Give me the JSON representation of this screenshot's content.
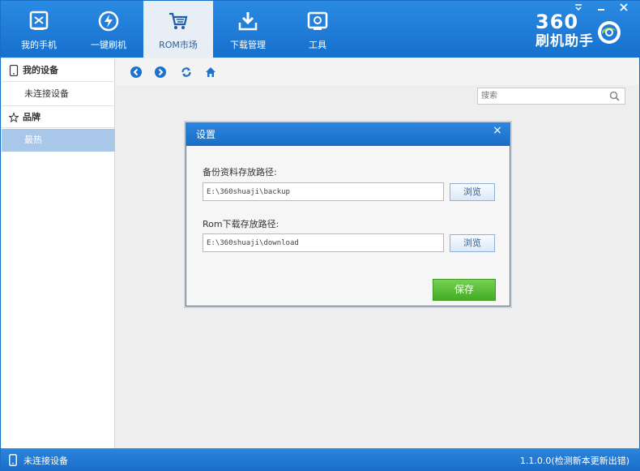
{
  "window": {
    "minimize_label": "–",
    "close_label": "×",
    "menu_label": "≡"
  },
  "tabs": [
    {
      "label": "我的手机",
      "icon": "phone-icon"
    },
    {
      "label": "一键刷机",
      "icon": "flash-icon"
    },
    {
      "label": "ROM市场",
      "icon": "cart-icon"
    },
    {
      "label": "下载管理",
      "icon": "download-icon"
    },
    {
      "label": "工具",
      "icon": "toolbox-icon"
    }
  ],
  "active_tab": "ROM市场",
  "logo": {
    "number": "360",
    "text": "刷机助手"
  },
  "sidebar": {
    "device_header": "我的设备",
    "device_item": "未连接设备",
    "brand_header": "品牌",
    "brand_item": "最热"
  },
  "search": {
    "placeholder": "搜索"
  },
  "dialog": {
    "title": "设置",
    "close_label": "×",
    "backup_label": "备份资料存放路径:",
    "backup_path": "E:\\360shuaji\\backup",
    "download_label": "Rom下载存放路径:",
    "download_path": "E:\\360shuaji\\download",
    "browse_label": "浏览",
    "save_label": "保存"
  },
  "status": {
    "left": "未连接设备",
    "right": "1.1.0.0(检测新本更新出错)"
  },
  "colors": {
    "accent": "#1a6fc4",
    "save": "#4fb52c",
    "sidebar_selected": "#a9c7e8"
  }
}
